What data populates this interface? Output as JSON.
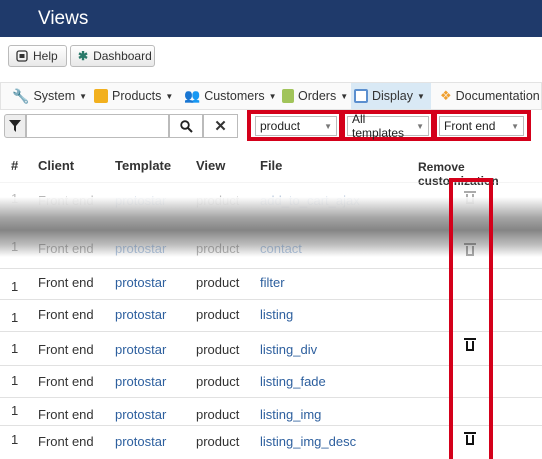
{
  "header": {
    "title": "Views"
  },
  "toolbar": {
    "help_label": "Help",
    "dashboard_label": "Dashboard"
  },
  "menu": {
    "items": [
      {
        "label": "System",
        "icon": "wrench-icon",
        "color": "#3c78b4"
      },
      {
        "label": "Products",
        "icon": "products-icon",
        "color": "#f2b01e"
      },
      {
        "label": "Customers",
        "icon": "customers-icon",
        "color": "#6aa1d6"
      },
      {
        "label": "Orders",
        "icon": "orders-icon",
        "color": "#a1c45a"
      },
      {
        "label": "Display",
        "icon": "display-icon",
        "color": "#5b8fcf"
      },
      {
        "label": "Documentation",
        "icon": "documentation-icon",
        "color": "#f0a030"
      }
    ]
  },
  "filters": {
    "search_value": "",
    "view": "product",
    "template": "All templates",
    "client": "Front end"
  },
  "table": {
    "headers": {
      "num": "#",
      "client": "Client",
      "template": "Template",
      "view": "View",
      "file": "File",
      "remove": "Remove customization"
    },
    "rows": [
      {
        "num": "1",
        "client": "Front end",
        "template": "protostar",
        "view": "product",
        "file": "add_to_cart_ajax",
        "removable": true
      },
      {
        "num": "1",
        "client": "Front end",
        "template": "protostar",
        "view": "product",
        "file": "contact",
        "removable": true
      },
      {
        "num": "1",
        "client": "Front end",
        "template": "protostar",
        "view": "product",
        "file": "filter",
        "removable": false
      },
      {
        "num": "1",
        "client": "Front end",
        "template": "protostar",
        "view": "product",
        "file": "listing",
        "removable": false
      },
      {
        "num": "1",
        "client": "Front end",
        "template": "protostar",
        "view": "product",
        "file": "listing_div",
        "removable": true
      },
      {
        "num": "1",
        "client": "Front end",
        "template": "protostar",
        "view": "product",
        "file": "listing_fade",
        "removable": false
      },
      {
        "num": "1",
        "client": "Front end",
        "template": "protostar",
        "view": "product",
        "file": "listing_img",
        "removable": false
      },
      {
        "num": "1",
        "client": "Front end",
        "template": "protostar",
        "view": "product",
        "file": "listing_img_desc",
        "removable": true
      }
    ]
  },
  "colors": {
    "topbar": "#1f3a6b",
    "link": "#2d5f9e",
    "highlight": "#d4001a"
  }
}
